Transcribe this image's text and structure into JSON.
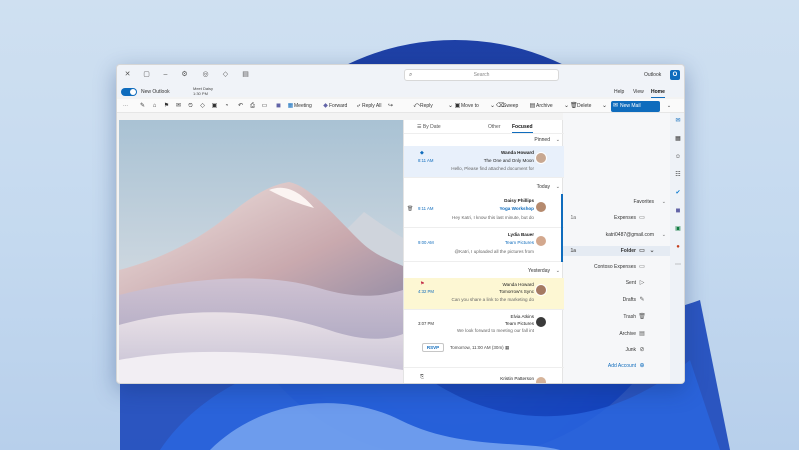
{
  "app": {
    "title": "Outlook",
    "logo": "outlook-icon"
  },
  "search": {
    "placeholder": "Search"
  },
  "titlebar_icons": [
    "close-icon",
    "maximize-icon",
    "minimize-icon",
    "settings-icon",
    "tips-icon",
    "premium-icon",
    "my-day-icon"
  ],
  "ribbon_tabs": {
    "toggle_label": "New Outlook",
    "meet_name": "Meet Daisy",
    "meet_time": "1:30 PM",
    "tabs": [
      "Help",
      "View",
      "Home"
    ],
    "active": "Home"
  },
  "ribbon": {
    "more": "⋯",
    "new_mail": "New Mail",
    "delete": "Delete",
    "archive": "Archive",
    "sweep": "Sweep",
    "move_to": "Move to",
    "reply": "Reply",
    "reply_all": "Reply All",
    "forward": "Forward",
    "meeting": "Meeting"
  },
  "folders": {
    "favorites": "Favorites",
    "expenses": "Expenses",
    "account": "katri0487@gmail.com",
    "folder": "Folder",
    "contoso": "Contoso Expenses",
    "sent": "Sent",
    "drafts": "Drafts",
    "trash": "Trash",
    "archive": "Archive",
    "junk": "Junk",
    "add_account": "Add Account",
    "count_1a": "1a"
  },
  "message_list": {
    "tabs": {
      "focused": "Focused",
      "other": "Other",
      "by_date": "By Date"
    },
    "sections": {
      "pinned": "Pinned",
      "today": "Today",
      "yesterday": "Yesterday"
    },
    "messages": [
      {
        "sender": "Wanda Howard",
        "subject": "The One and Only Moon",
        "preview": "Hello, Please find attached document for",
        "time": "8:11 AM"
      },
      {
        "sender": "Daisy Phillips",
        "subject": "Yoga Workshop",
        "preview": "Hey Katri, I know this last minute, but do",
        "time": "9:11 AM"
      },
      {
        "sender": "Lydia Bauer",
        "subject": "Team Pictures",
        "preview": "@Katri, I uploaded all the pictures from",
        "time": "9:00 AM"
      },
      {
        "sender": "Wanda Howard",
        "subject": "Tomorrow's Sync",
        "preview": "Can you share a link to the marketing do",
        "time": "4:32 PM"
      },
      {
        "sender": "Elvia Atkins",
        "subject": "Team Pictures",
        "preview": "We look forward to meeting our fall int",
        "time": "3:07 PM"
      },
      {
        "sender": "Kristin Patterson",
        "subject": "",
        "preview": "",
        "time": ""
      }
    ],
    "rsvp": "RSVP",
    "event": "Tomorrow, 11:00 AM (30m)"
  }
}
